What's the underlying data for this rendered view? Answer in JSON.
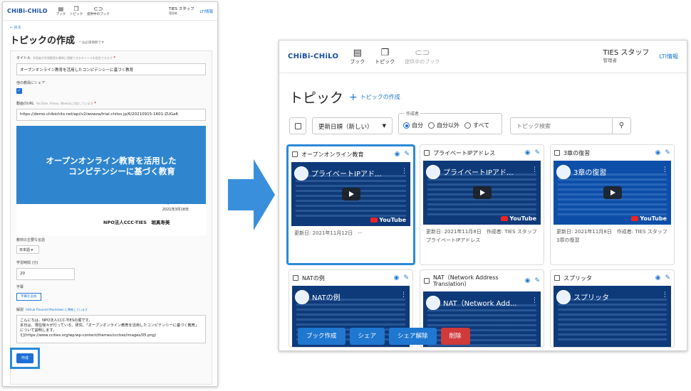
{
  "left": {
    "logo": "CHiBi-CHiLO",
    "nav": [
      {
        "label": "ブック",
        "icon": "book-icon"
      },
      {
        "label": "トピック",
        "icon": "topic-icon"
      },
      {
        "label": "提供中のブック",
        "icon": "link-icon"
      }
    ],
    "user_name": "TIES スタッフ",
    "user_role": "管理者",
    "lti": "LTI情報",
    "back": "← 戻る",
    "title": "トピックの作成",
    "required_note": "* は必須項目です",
    "title_label": "タイトル",
    "title_hint": "学習者が学習範囲を簡単に理解できるタイトルを設定できます",
    "title_value": "オープンオンライン教育を活用したコンピテンシーに基づく教育",
    "share_label": "他の教員にシェア",
    "video_url_label": "動画のURL",
    "video_url_hint": "YouTube, Vimeo, Wowzaに対応しています",
    "video_url_value": "https://demo.chibichilo.net/api/v2/wowza/trial.chilos.jp/6/20210915-1601-ZUGa6",
    "video_title_line1": "オープンオンライン教育を活用した",
    "video_title_line2": "コンピテンシーに基づく教育",
    "video_date": "2021年3月18日",
    "video_org": "NPO法人CCC-TIES　堀真寿美",
    "language_label": "教材の主要な言語",
    "language_value": "日本語 ▾",
    "time_label": "学習時間 (分)",
    "time_value": "20",
    "subtitle_label": "字幕",
    "subtitle_button": "字幕を追加",
    "desc_label": "解説",
    "desc_hint": "Github Flavored Markdown に準拠しています",
    "desc_line1": "こんにちは、NPO法人CCC-TIESの堀です。",
    "desc_line2": "本日は、現在我々が行っている、研究、「オープンオンライン教育を活用したコンピテンシーに基づく教育」について説明します。",
    "desc_line3": "![](https://www.ccities.org/wp/wp-content/themes/cccties/images/05.png)",
    "save_button": "作成"
  },
  "right": {
    "logo": "CHiBi-CHiLO",
    "nav": [
      {
        "label": "ブック",
        "icon": "book-icon"
      },
      {
        "label": "トピック",
        "icon": "topic-icon"
      },
      {
        "label": "提供中のブック",
        "icon": "link-icon"
      }
    ],
    "user_name": "TIES スタッフ",
    "user_role": "管理者",
    "lti": "LTI情報",
    "title": "トピック",
    "create_link": "トピックの作成",
    "sort_value": "更新日順（新しい）",
    "author_label": "作成者",
    "author_options": [
      "自分",
      "自分以外",
      "すべて"
    ],
    "search_placeholder": "トピック検索",
    "cards": [
      {
        "title": "オープンオンライン教育",
        "video_title": "プライベートIPアド...",
        "meta1": "更新日: 2021年11月12日　···",
        "meta2": ""
      },
      {
        "title": "プライベートIPアドレス",
        "video_title": "プライベートIPアド...",
        "meta1": "更新日: 2021年11月8日　作成者: TIES スタッフ",
        "meta2": "プライベートIPアドレス"
      },
      {
        "title": "3章の復習",
        "video_title": "3章の復習",
        "meta1": "更新日: 2021年11月8日　作成者: TIES スタッフ",
        "meta2": "3章の復習"
      },
      {
        "title": "NATの例",
        "video_title": "NATの例",
        "meta1": "",
        "meta2": ""
      },
      {
        "title": "NAT（Network Address Translation）",
        "video_title": "NAT（Network Add...",
        "meta1": "",
        "meta2": ""
      },
      {
        "title": "スプリッタ",
        "video_title": "スプリッタ",
        "meta1": "",
        "meta2": ""
      }
    ],
    "youtube_label": "YouTube",
    "actions": [
      {
        "label": "ブック作成",
        "style": "primary"
      },
      {
        "label": "シェア",
        "style": "primary"
      },
      {
        "label": "シェア解除",
        "style": "primary"
      },
      {
        "label": "削除",
        "style": "danger"
      }
    ]
  }
}
